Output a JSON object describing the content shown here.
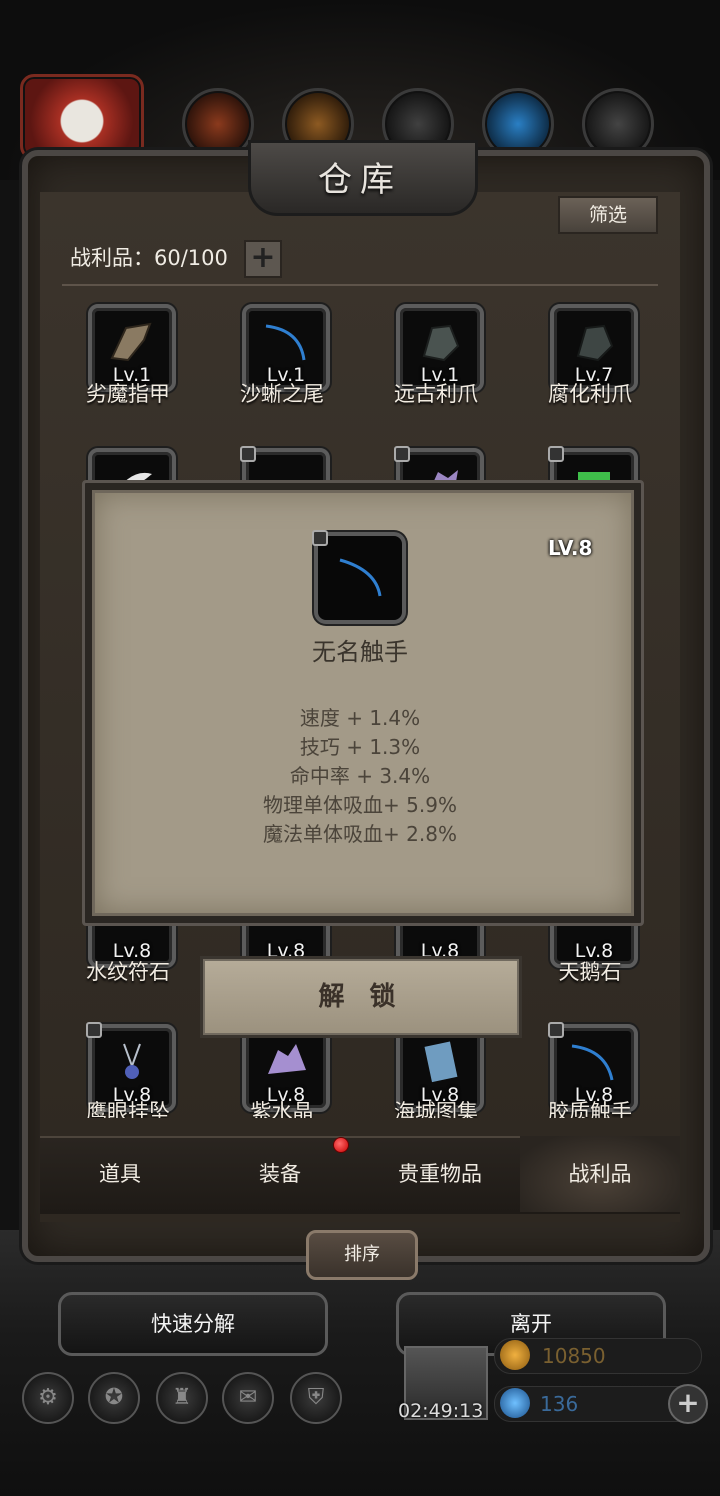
{
  "window": {
    "title": "仓库"
  },
  "toolbar": {
    "filter_label": "筛选",
    "sort_label": "排序"
  },
  "inventory": {
    "label": "战利品：60/100",
    "add_symbol": "+"
  },
  "items_row1": [
    {
      "level": "Lv.1",
      "name": "劣魔指甲"
    },
    {
      "level": "Lv.1",
      "name": "沙蜥之尾"
    },
    {
      "level": "Lv.1",
      "name": "远古利爪"
    },
    {
      "level": "Lv.7",
      "name": "腐化利爪"
    }
  ],
  "items_row3": [
    {
      "level": "Lv.8",
      "name": "水纹符石"
    },
    {
      "level": "Lv.8",
      "name": ""
    },
    {
      "level": "Lv.8",
      "name": ""
    },
    {
      "level": "Lv.8",
      "name": "天鹅石"
    }
  ],
  "items_row4": [
    {
      "level": "Lv.8",
      "name": "鹰眼挂坠"
    },
    {
      "level": "Lv.8",
      "name": "紫水晶"
    },
    {
      "level": "Lv.8",
      "name": "海城图集"
    },
    {
      "level": "Lv.8",
      "name": "胶质触手"
    }
  ],
  "popup": {
    "level": "LV.8",
    "item_name": "无名触手",
    "stats": [
      "速度 + 1.4%",
      "技巧 + 1.3%",
      "命中率 + 3.4%",
      "物理单体吸血+ 5.9%",
      "魔法单体吸血+ 2.8%"
    ],
    "unlock_label": "解 锁"
  },
  "tabs": [
    {
      "label": "道具"
    },
    {
      "label": "装备"
    },
    {
      "label": "贵重物品"
    },
    {
      "label": "战利品"
    }
  ],
  "actions": {
    "quick_decompose": "快速分解",
    "leave": "离开"
  },
  "footer": {
    "timer": "02:49:13",
    "gold": "10850",
    "gems": "136",
    "gems_add": "+"
  },
  "colors": {
    "panel": "#2f2a24",
    "popup": "#a39a88",
    "notification": "#e01a1a"
  }
}
